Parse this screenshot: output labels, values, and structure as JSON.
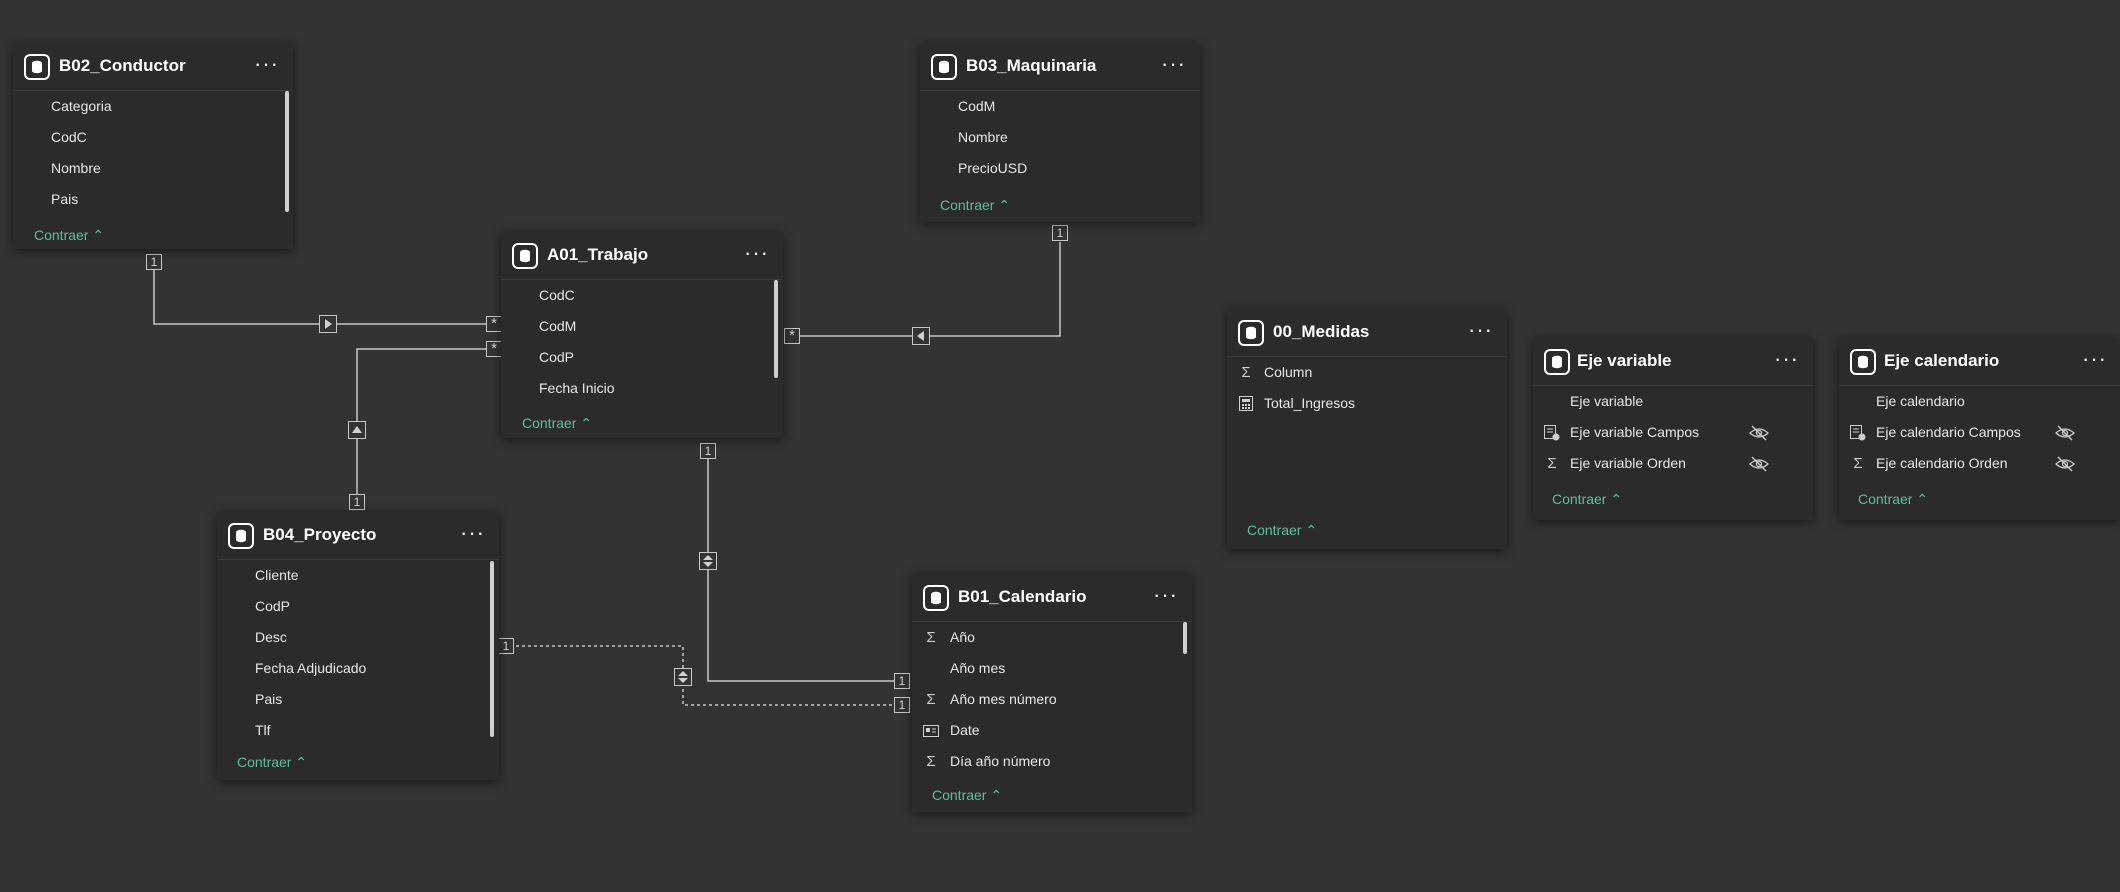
{
  "tables": {
    "b02": {
      "name": "B02_Conductor",
      "fields": [
        "Categoria",
        "CodC",
        "Nombre",
        "Pais"
      ],
      "collapse": "Contraer"
    },
    "b03": {
      "name": "B03_Maquinaria",
      "fields": [
        "CodM",
        "Nombre",
        "PrecioUSD"
      ],
      "collapse": "Contraer"
    },
    "a01": {
      "name": "A01_Trabajo",
      "fields": [
        "CodC",
        "CodM",
        "CodP",
        "Fecha Inicio"
      ],
      "collapse": "Contraer"
    },
    "b04": {
      "name": "B04_Proyecto",
      "fields": [
        "Cliente",
        "CodP",
        "Desc",
        "Fecha Adjudicado",
        "Pais",
        "Tlf"
      ],
      "collapse": "Contraer"
    },
    "b01": {
      "name": "B01_Calendario",
      "fields": [
        "Año",
        "Año mes",
        "Año mes número",
        "Date",
        "Día año número"
      ],
      "collapse": "Contraer"
    },
    "medidas": {
      "name": "00_Medidas",
      "fields": [
        "Column",
        "Total_Ingresos"
      ],
      "collapse": "Contraer"
    },
    "ejevar": {
      "name": "Eje variable",
      "fields": [
        "Eje variable",
        "Eje variable Campos",
        "Eje variable Orden"
      ],
      "collapse": "Contraer"
    },
    "ejecal": {
      "name": "Eje calendario",
      "fields": [
        "Eje calendario",
        "Eje calendario Campos",
        "Eje calendario Orden"
      ],
      "collapse": "Contraer"
    }
  },
  "markers": {
    "one": "1",
    "many": "*"
  },
  "icons": {
    "table": "database-icon",
    "sigma": "Σ",
    "more": "···",
    "collapse_chevron": "^"
  },
  "colors": {
    "background": "#333333",
    "card": "#2b2b2b",
    "accent": "#5fbf9a",
    "line": "#c8c8c8"
  }
}
